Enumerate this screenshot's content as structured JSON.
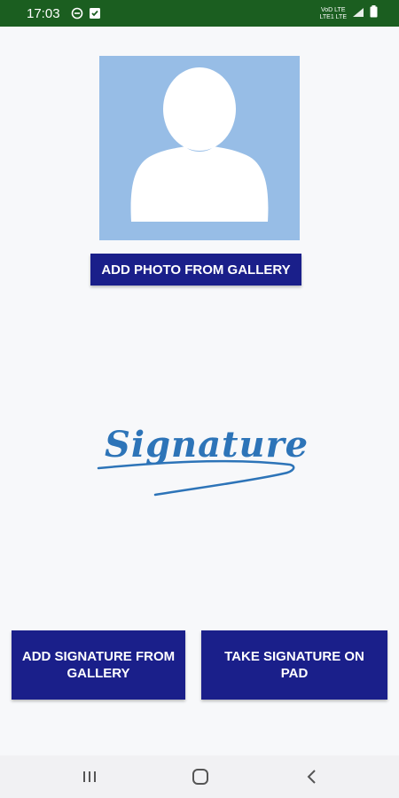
{
  "status_bar": {
    "time": "17:03",
    "network_top": "VoD LTE",
    "network_bottom": "LTE1 LTE"
  },
  "profile": {
    "add_photo_label": "ADD PHOTO FROM GALLERY",
    "placeholder_icon": "person-silhouette-icon"
  },
  "signature": {
    "image_text": "Signature"
  },
  "actions": {
    "add_signature_gallery_label": "ADD SIGNATURE FROM GALLERY",
    "take_signature_pad_label": "TAKE SIGNATURE ON PAD"
  },
  "nav": {
    "recents_icon": "recents-icon",
    "home_icon": "home-icon",
    "back_icon": "back-icon"
  },
  "colors": {
    "status_bar": "#1b5e20",
    "button": "#1a1f8a",
    "avatar_bg": "#97bde6",
    "signature_ink": "#2d74b8"
  }
}
